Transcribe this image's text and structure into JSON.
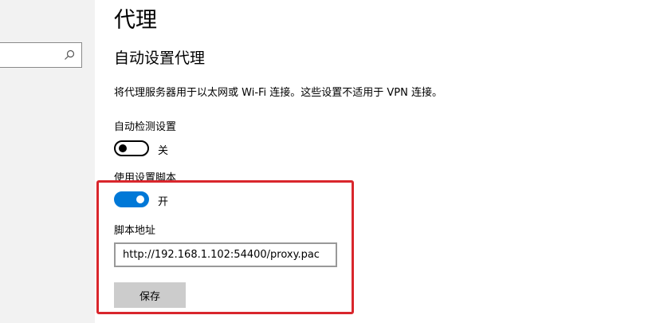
{
  "sidebar": {
    "search": {
      "value": "",
      "icon": "search-icon"
    }
  },
  "page": {
    "title": "代理",
    "section_title": "自动设置代理",
    "description": "将代理服务器用于以太网或 Wi-Fi 连接。这些设置不适用于 VPN 连接。"
  },
  "auto_detect": {
    "label": "自动检测设置",
    "state_label": "关",
    "enabled": false
  },
  "setup_script": {
    "label": "使用设置脚本",
    "state_label": "开",
    "enabled": true,
    "address_label": "脚本地址",
    "address_value": "http://192.168.1.102:54400/proxy.pac",
    "save_label": "保存"
  },
  "colors": {
    "accent": "#0078d7",
    "highlight": "#d9262c",
    "sidebar_bg": "#f2f2f2",
    "button_bg": "#cccccc"
  }
}
